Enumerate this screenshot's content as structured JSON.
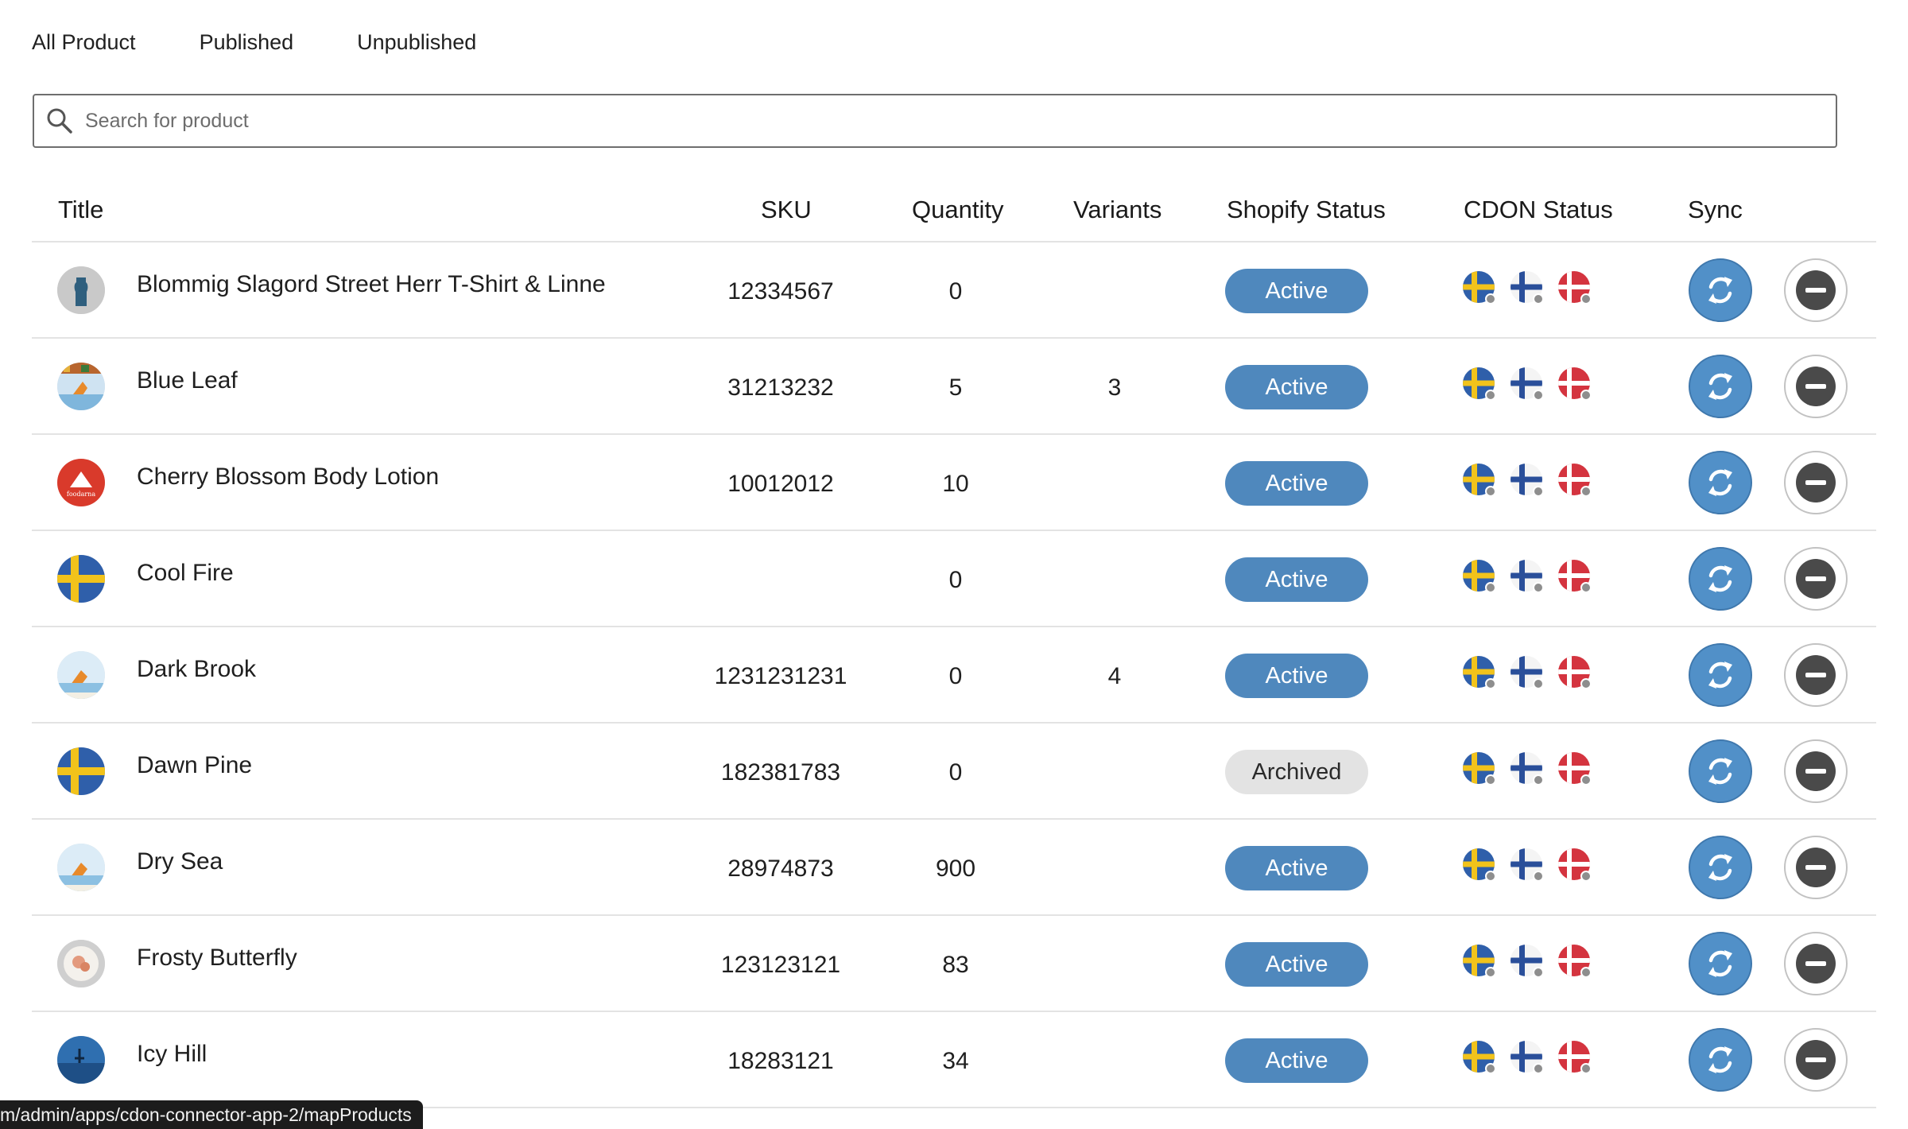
{
  "tabs": [
    "All Product",
    "Published",
    "Unpublished"
  ],
  "search": {
    "placeholder": "Search for product"
  },
  "columns": {
    "title": "Title",
    "sku": "SKU",
    "quantity": "Quantity",
    "variants": "Variants",
    "shopify_status": "Shopify Status",
    "cdon_status": "CDON Status",
    "sync": "Sync"
  },
  "rows": [
    {
      "title": "Blommig Slagord Street Herr T-Shirt & Linne",
      "sku": "12334567",
      "quantity": "0",
      "variants": "",
      "status": "Active",
      "thumb": "tshirt"
    },
    {
      "title": "Blue Leaf",
      "sku": "31213232",
      "quantity": "5",
      "variants": "3",
      "status": "Active",
      "thumb": "beach-colorful"
    },
    {
      "title": "Cherry Blossom Body Lotion",
      "sku": "10012012",
      "quantity": "10",
      "variants": "",
      "status": "Active",
      "thumb": "foodarna-logo"
    },
    {
      "title": "Cool Fire",
      "sku": "",
      "quantity": "0",
      "variants": "",
      "status": "Active",
      "thumb": "sweden-flag"
    },
    {
      "title": "Dark Brook",
      "sku": "1231231231",
      "quantity": "0",
      "variants": "4",
      "status": "Active",
      "thumb": "beach"
    },
    {
      "title": "Dawn Pine",
      "sku": "182381783",
      "quantity": "0",
      "variants": "",
      "status": "Archived",
      "thumb": "sweden-flag"
    },
    {
      "title": "Dry Sea",
      "sku": "28974873",
      "quantity": "900",
      "variants": "",
      "status": "Active",
      "thumb": "beach"
    },
    {
      "title": "Frosty Butterfly",
      "sku": "123123121",
      "quantity": "83",
      "variants": "",
      "status": "Active",
      "thumb": "plate"
    },
    {
      "title": "Icy Hill",
      "sku": "18283121",
      "quantity": "34",
      "variants": "",
      "status": "Active",
      "thumb": "ocean"
    }
  ],
  "markets": [
    "sweden-flag-icon",
    "finland-flag-icon",
    "denmark-flag-icon"
  ],
  "logo_text": "foodarna",
  "status_url": "m/admin/apps/cdon-connector-app-2/mapProducts",
  "colors": {
    "active_badge": "#4f88bd",
    "archived_badge": "#e3e3e3",
    "sync_button": "#5190c8",
    "remove_button": "#4a4a4a"
  }
}
